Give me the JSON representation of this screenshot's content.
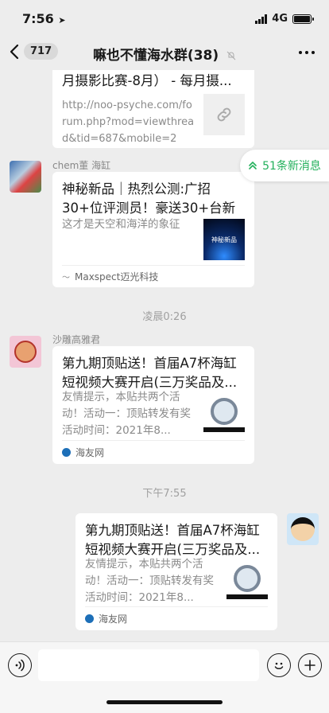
{
  "status": {
    "time": "7:56",
    "network": "4G"
  },
  "nav": {
    "back_count": "717",
    "title": "嘛也不懂海水群(38)"
  },
  "new_messages": "51条新消息",
  "messages": [
    {
      "title_partial": "月摄影比赛-8月） - 每月摄...",
      "url": "http://noo-psyche.com/forum.php?mod=viewthread&tid=687&mobile=2",
      "url_lines": [
        "http://noo-psyche.com/fo",
        "rum.php?mod=viewthrea",
        "d&tid=687&mobile=2"
      ]
    },
    {
      "sender": "chem董 海缸",
      "title": "神秘新品｜热烈公测:广招30+位评测员！豪送30+台新品...",
      "desc": "这才是天空和海洋的象征",
      "thumb_text": "神秘新品",
      "source": "Maxspect迈光科技"
    },
    {
      "time": "凌晨0:26"
    },
    {
      "sender": "沙雕高雅君",
      "title": "第九期顶贴送！首届A7杯海缸短视频大赛开启(三万奖品及...",
      "desc": "友情提示，本贴共两个活动！活动一：顶贴转发有奖活动时间：2021年8...",
      "source": "海友网"
    },
    {
      "time": "下午7:55"
    },
    {
      "title": "第九期顶贴送！首届A7杯海缸短视频大赛开启(三万奖品及...",
      "desc": "友情提示，本贴共两个活动！活动一：顶贴转发有奖活动时间：2021年8...",
      "source": "海友网"
    }
  ],
  "colors": {
    "background": "#ededed",
    "accent": "#23b05c",
    "card": "#ffffff"
  },
  "icons": [
    "back-chevron-icon",
    "mute-bell-icon",
    "more-dots-icon",
    "double-up-arrow-icon",
    "link-icon",
    "voice-icon",
    "emoji-icon",
    "plus-icon"
  ]
}
